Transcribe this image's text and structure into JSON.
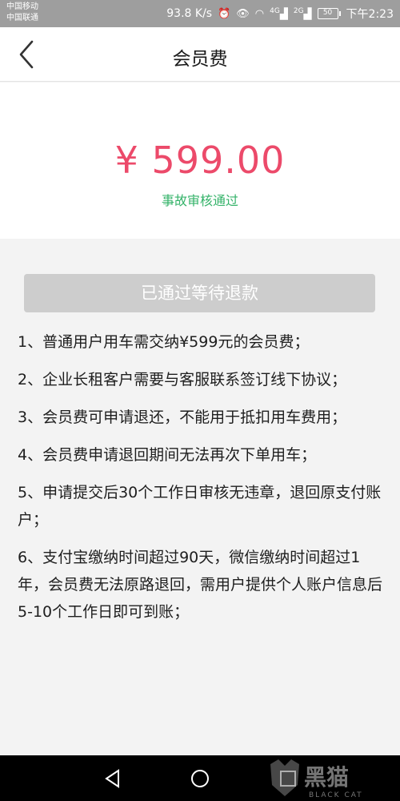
{
  "status_bar": {
    "carrier_1": "中国移动",
    "carrier_2": "中国联通",
    "speed": "93.8 K/s",
    "net_4g": "4G",
    "net_2g": "2G",
    "battery": "50",
    "time": "下午2:23"
  },
  "header": {
    "title": "会员费"
  },
  "amount": {
    "value": "¥ 599.00",
    "status": "事故审核通过",
    "value_color": "#ec4a6a",
    "status_color": "#35b36a"
  },
  "refund_button": {
    "label": "已通过等待退款"
  },
  "rules": [
    "1、普通用户用车需交纳¥599元的会员费；",
    "2、企业长租客户需要与客服联系签订线下协议；",
    "3、会员费可申请退还，不能用于抵扣用车费用；",
    "4、会员费申请退回期间无法再次下单用车；",
    "5、申请提交后30个工作日审核无违章，退回原支付账户；",
    "6、支付宝缴纳时间超过90天，微信缴纳时间超过1年，会员费无法原路退回，需用户提供个人账户信息后5-10个工作日即可到账；"
  ],
  "watermark": {
    "text": "黑猫",
    "subtext": "BLACK CAT"
  }
}
